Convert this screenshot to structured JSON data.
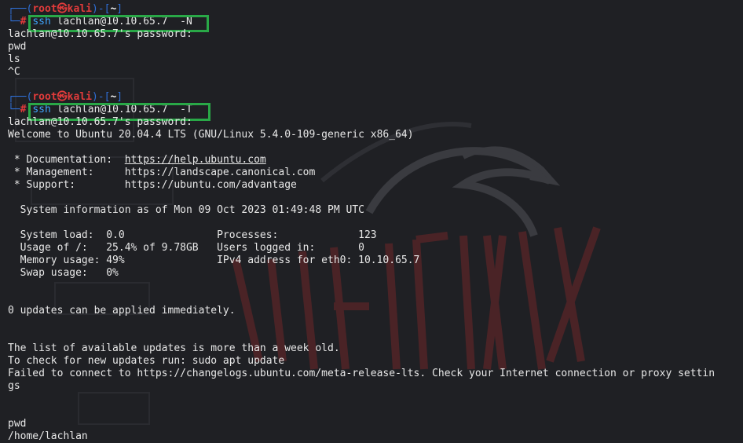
{
  "terminal": {
    "prompt1": {
      "user": "root",
      "at_symbol": "㉿",
      "host": "kali",
      "path": "~",
      "command_name": "ssh",
      "command_args": " lachlan@10.10.65.7  -N"
    },
    "output1": [
      "lachlan@10.10.65.7's password:",
      "pwd",
      "ls",
      "^C"
    ],
    "prompt2": {
      "user": "root",
      "at_symbol": "㉿",
      "host": "kali",
      "path": "~",
      "command_name": "ssh",
      "command_args": " lachlan@10.10.65.7  -T"
    },
    "output2": {
      "password_prompt": "lachlan@10.10.65.7's password:",
      "welcome": "Welcome to Ubuntu 20.04.4 LTS (GNU/Linux 5.4.0-109-generic x86_64)",
      "doc_label": " * Documentation:  ",
      "doc_url": "https://help.ubuntu.com",
      "mgmt": " * Management:     https://landscape.canonical.com",
      "support": " * Support:        https://ubuntu.com/advantage",
      "sysinfo": "  System information as of Mon 09 Oct 2023 01:49:48 PM UTC",
      "stats": [
        "  System load:  0.0               Processes:             123",
        "  Usage of /:   25.4% of 9.78GB   Users logged in:       0",
        "  Memory usage: 49%               IPv4 address for eth0: 10.10.65.7",
        "  Swap usage:   0%"
      ],
      "updates": "0 updates can be applied immediately.",
      "old_list": "The list of available updates is more than a week old.",
      "check": "To check for new updates run: sudo apt update",
      "failed": "Failed to connect to https://changelogs.ubuntu.com/meta-release-lts. Check your Internet connection or proxy settin",
      "failed_wrap": "gs",
      "pwd": "pwd",
      "home": "/home/lachlan"
    }
  },
  "colors": {
    "background": "#1f2024",
    "highlight": "#29a847",
    "prompt_red": "#e23b3b",
    "prompt_blue": "#2f6fd6",
    "command_blue": "#3fa7ff"
  }
}
